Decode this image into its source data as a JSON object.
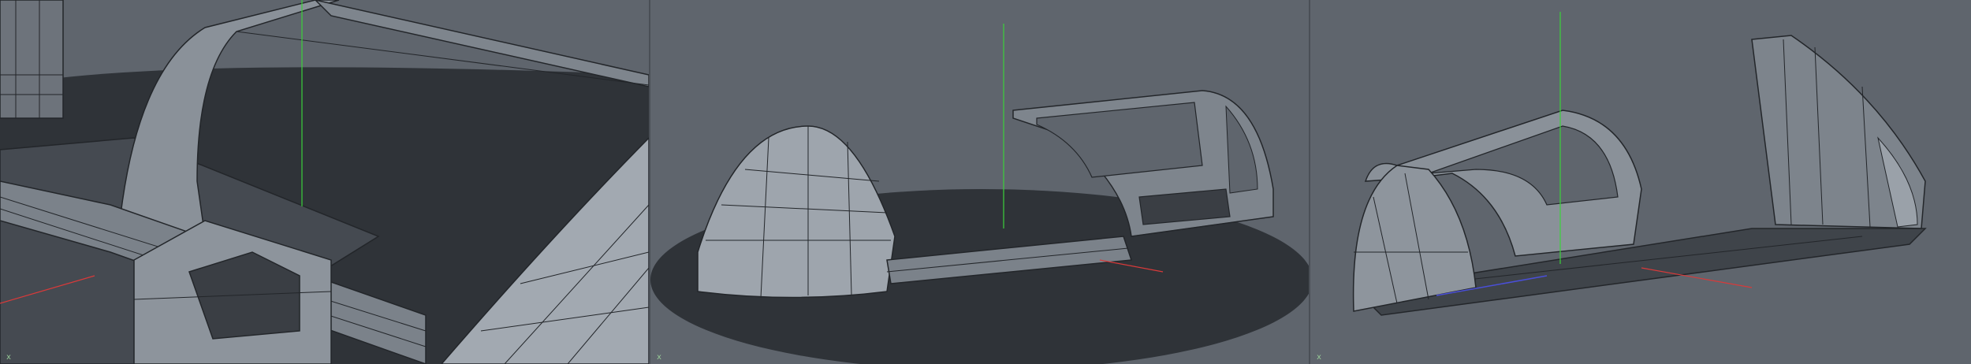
{
  "colors": {
    "background": "#5f656d",
    "ground_disc": "#2f3338",
    "mesh_light": "#9aa1a9",
    "mesh_mid": "#7c838b",
    "mesh_dark": "#4b5057",
    "wire": "#23262a",
    "axis_green": "#3bd13b",
    "axis_red": "#d83a3a",
    "axis_blue": "#4a4fd8"
  },
  "viewports": [
    {
      "name": "closeup-viewport",
      "axis_label": "x",
      "icon": "axis-gizmo-icon"
    },
    {
      "name": "front-perspective-viewport",
      "axis_label": "x",
      "icon": "axis-gizmo-icon"
    },
    {
      "name": "rear-perspective-viewport",
      "axis_label": "x",
      "icon": "axis-gizmo-icon"
    }
  ]
}
